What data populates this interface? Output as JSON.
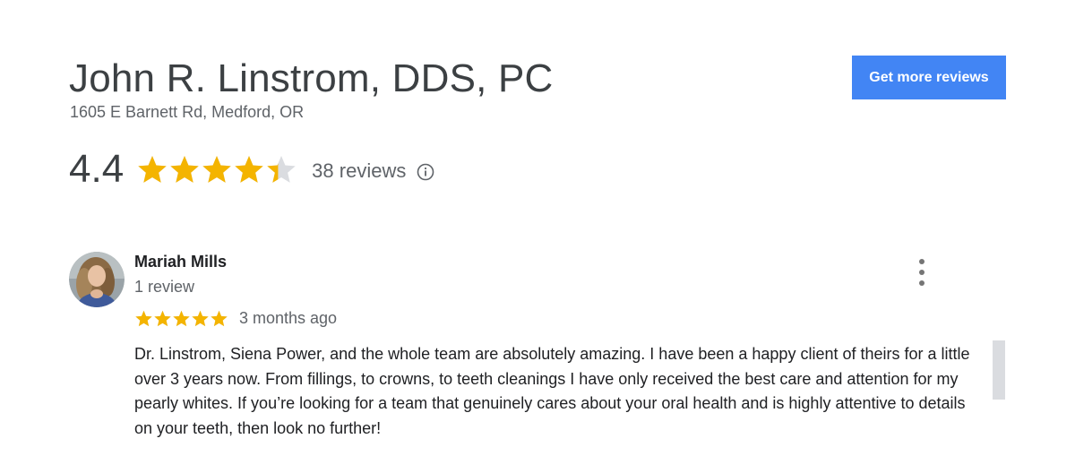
{
  "business": {
    "name": "John R. Linstrom, DDS, PC",
    "address": "1605 E Barnett Rd, Medford, OR"
  },
  "cta": {
    "label": "Get more reviews"
  },
  "rating": {
    "value": "4.4",
    "stars_filled": 4.4,
    "stars_total": 5,
    "review_count": "38 reviews",
    "info_icon": "info-circle-icon"
  },
  "review": {
    "author": "Mariah Mills",
    "author_reviews": "1 review",
    "stars": 5,
    "date": "3 months ago",
    "text": "Dr. Linstrom, Siena Power, and the whole team are absolutely amazing. I have been a happy client of theirs for a little over 3 years now. From fillings, to crowns, to teeth cleanings I have only received the best care and attention for my pearly whites. If you’re looking for a team that genuinely cares about your oral health and is highly attentive to details on your teeth, then look no further!",
    "menu_icon": "more-vert-icon"
  },
  "colors": {
    "accent": "#4285f4",
    "star": "#f4b400",
    "star_empty": "#dadce0",
    "text_primary": "#202124",
    "text_secondary": "#5f6368"
  }
}
